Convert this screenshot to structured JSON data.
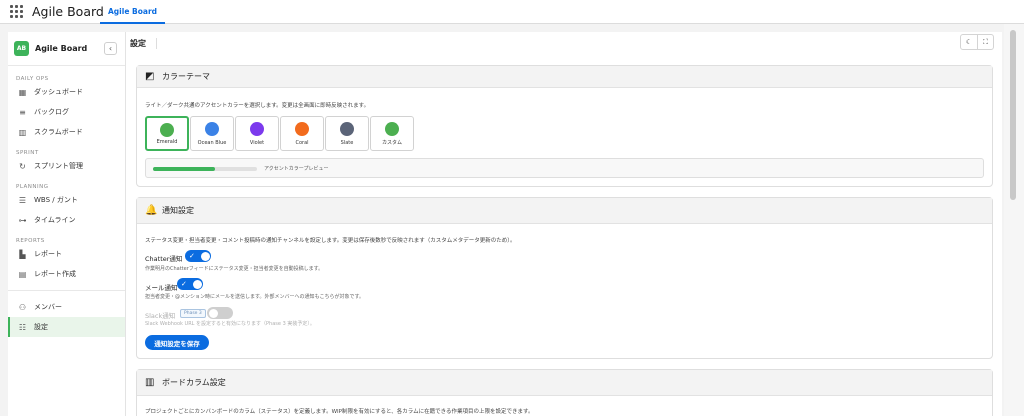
{
  "topbar": {
    "app_title": "Agile Board",
    "tab_label": "Agile Board"
  },
  "sidebar": {
    "brand_logo": "AB",
    "brand_name": "Agile Board",
    "collapse_glyph": "‹",
    "sections": {
      "daily_ops": "DAILY OPS",
      "sprint": "SPRINT",
      "planning": "PLANNING",
      "reports": "REPORTS"
    },
    "items": {
      "dashboard": "ダッシュボード",
      "backlog": "バックログ",
      "scrum": "スクラムボード",
      "sprint_mgmt": "スプリント管理",
      "wbs": "WBS / ガント",
      "timeline": "タイムライン",
      "report": "レポート",
      "report_create": "レポート作成",
      "members": "メンバー",
      "settings": "設定"
    }
  },
  "main": {
    "page_title": "設定",
    "theme_btn": "☾",
    "fullscreen_btn": "⛶"
  },
  "color_theme": {
    "title": "カラーテーマ",
    "description": "ライト／ダーク共通のアクセントカラーを選択します。変更は全画面に即時反映されます。",
    "options": [
      {
        "label": "Emerald",
        "color": "#4caf50",
        "selected": true
      },
      {
        "label": "Ocean Blue",
        "color": "#3b82e6"
      },
      {
        "label": "Violet",
        "color": "#7c3aed"
      },
      {
        "label": "Coral",
        "color": "#f26b1d"
      },
      {
        "label": "Slate",
        "color": "#5b6478"
      },
      {
        "label": "カスタム",
        "color": "#4caf50"
      }
    ],
    "preview_label": "アクセントカラープレビュー",
    "preview_progress": 0.6,
    "accent_color": "#3db35a"
  },
  "notifications": {
    "title": "通知設定",
    "description": "ステータス変更・担当者変更・コメント投稿時の通知チャンネルを設定します。変更は保存後数秒で反映されます（カスタムメタデータ更新のため）。",
    "chatter": {
      "label": "Chatter通知",
      "desc": "作業明月のChatterフィードにステータス変更・担当者変更を自動投稿します。",
      "enabled": true
    },
    "mail": {
      "label": "メール通知",
      "desc": "担当者変更・@メンション時にメールを送信します。外部メンバーへの通知もこちらが対象です。",
      "enabled": true
    },
    "slack": {
      "label": "Slack通知",
      "badge": "Phase 3",
      "desc": "Slack Webhook URL を設定すると有効になります（Phase 3 実装予定）。",
      "enabled": false
    },
    "save_label": "通知設定を保存"
  },
  "board_columns": {
    "title": "ボードカラム設定",
    "description": "プロジェクトごとにカンバンボードのカラム（ステータス）を定義します。WIP制限を有効にすると、各カラムに在籍できる作業項目の上限を設定できます。"
  }
}
